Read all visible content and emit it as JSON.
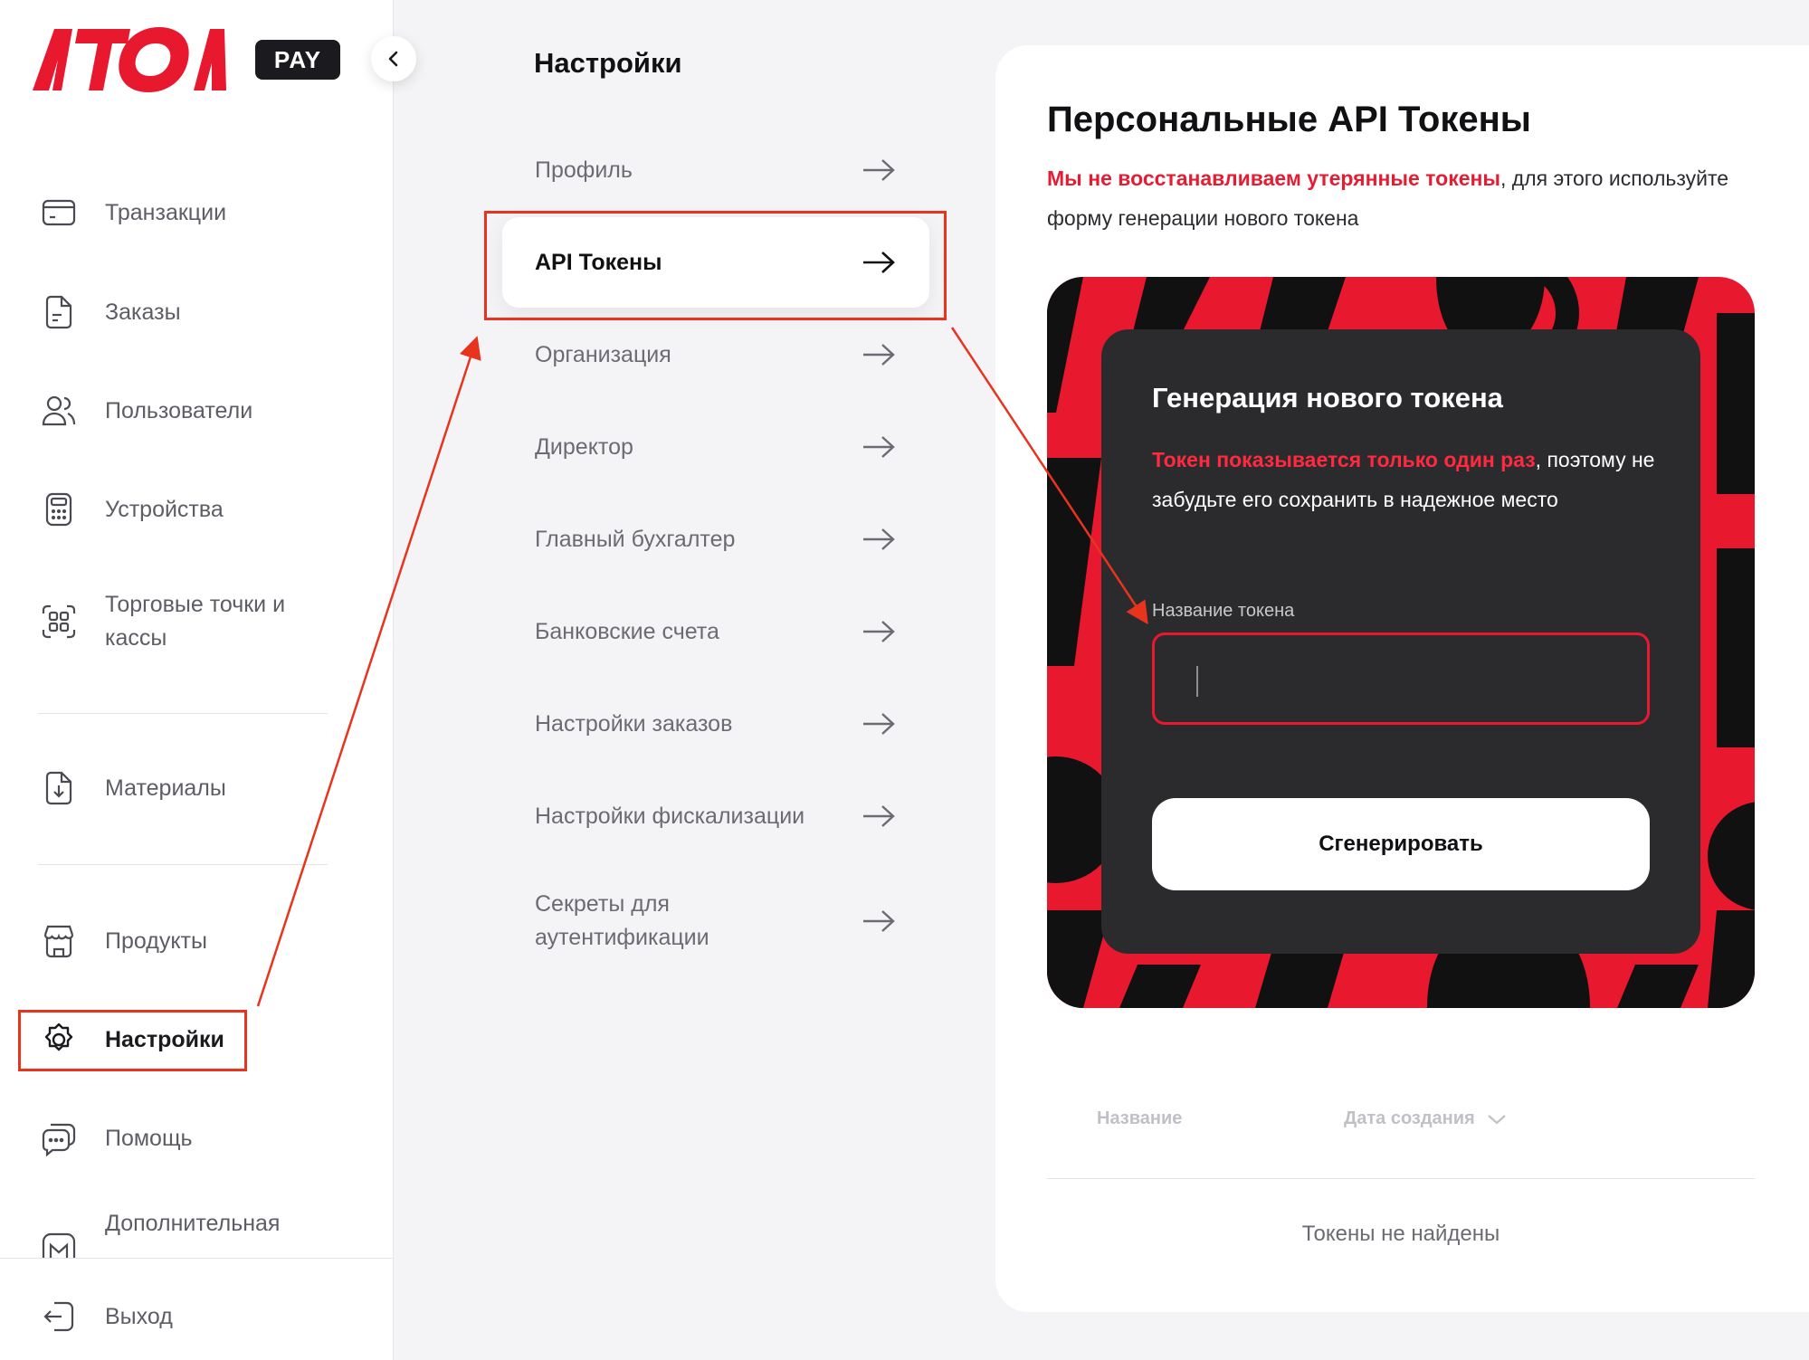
{
  "brand": {
    "logo_text": "ATOL",
    "badge": "PAY",
    "accent_color": "#e8192f",
    "dark_color": "#1b1b1f"
  },
  "sidebar": {
    "items": [
      {
        "label": "Транзакции",
        "icon": "transactions-icon"
      },
      {
        "label": "Заказы",
        "icon": "orders-icon"
      },
      {
        "label": "Пользователи",
        "icon": "users-icon"
      },
      {
        "label": "Устройства",
        "icon": "devices-icon"
      },
      {
        "label": "Торговые точки и кассы",
        "icon": "stores-icon"
      },
      {
        "label": "Материалы",
        "icon": "materials-icon"
      },
      {
        "label": "Продукты",
        "icon": "products-icon"
      },
      {
        "label": "Настройки",
        "icon": "gear-icon",
        "active": true
      },
      {
        "label": "Помощь",
        "icon": "help-chat-icon"
      },
      {
        "label": "Дополнительная",
        "icon": "more-icon"
      },
      {
        "label": "Выход",
        "icon": "logout-icon"
      }
    ]
  },
  "settings": {
    "title": "Настройки",
    "items": [
      {
        "label": "Профиль"
      },
      {
        "label": "API Токены",
        "selected": true
      },
      {
        "label": "Организация"
      },
      {
        "label": "Директор"
      },
      {
        "label": "Главный бухгалтер"
      },
      {
        "label": "Банковские счета"
      },
      {
        "label": "Настройки заказов"
      },
      {
        "label": "Настройки фискализации"
      },
      {
        "label": "Секреты для аутентификации"
      }
    ]
  },
  "main": {
    "title": "Персональные API Токены",
    "subtitle_warning": "Мы не восстанавливаем утерянные токены",
    "subtitle_rest": ", для этого используйте форму генерации нового токена",
    "generate": {
      "title": "Генерация нового токена",
      "warning": "Токен показывается только один раз",
      "desc_rest": ", поэтому не забудьте его сохранить в надежное место",
      "field_label": "Название токена",
      "field_value": "",
      "button": "Сгенерировать"
    },
    "table": {
      "columns": [
        "Название",
        "Дата создания"
      ],
      "empty": "Токены не найдены"
    }
  }
}
